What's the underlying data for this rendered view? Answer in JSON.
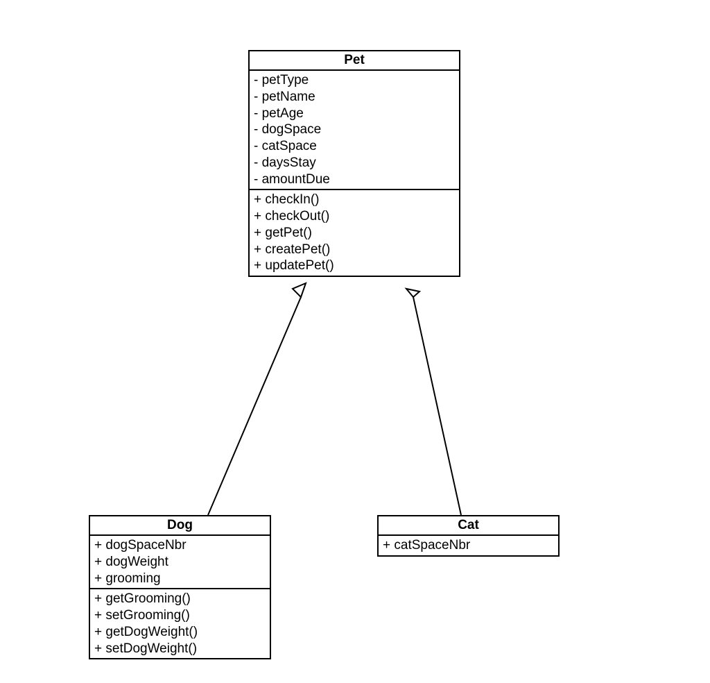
{
  "classes": {
    "pet": {
      "name": "Pet",
      "attributes": [
        "- petType",
        "- petName",
        "- petAge",
        "- dogSpace",
        "- catSpace",
        "- daysStay",
        "- amountDue"
      ],
      "methods": [
        "+ checkIn()",
        "+ checkOut()",
        "+ getPet()",
        "+ createPet()",
        "+ updatePet()"
      ]
    },
    "dog": {
      "name": "Dog",
      "attributes": [
        "+ dogSpaceNbr",
        "+ dogWeight",
        "+ grooming"
      ],
      "methods": [
        "+ getGrooming()",
        "+ setGrooming()",
        "+ getDogWeight()",
        "+ setDogWeight()"
      ]
    },
    "cat": {
      "name": "Cat",
      "attributes": [
        "+ catSpaceNbr"
      ],
      "methods": []
    }
  },
  "relationships": [
    {
      "from": "dog",
      "to": "pet",
      "type": "inheritance"
    },
    {
      "from": "cat",
      "to": "pet",
      "type": "inheritance"
    }
  ]
}
